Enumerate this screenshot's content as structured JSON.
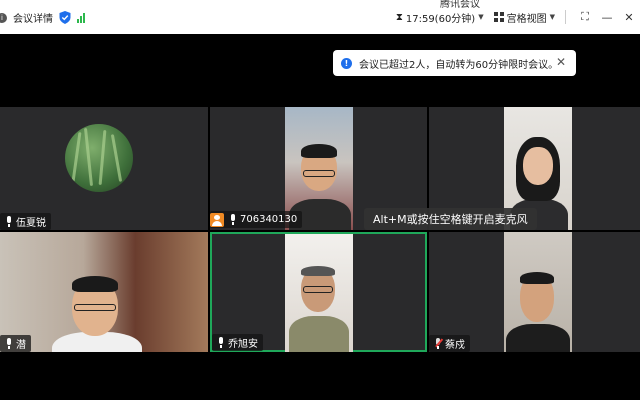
{
  "window": {
    "title": "腾讯会议"
  },
  "topbar": {
    "meeting_details_label": "会议详情",
    "timer_text": "17:59(60分钟)",
    "view_label": "宫格视图",
    "fullscreen_icon": "fullscreen-icon",
    "minimize_icon": "minimize-icon",
    "close_icon": "close-icon"
  },
  "notice": {
    "text": "会议已超过2人，自动转为60分钟限时会议。",
    "close_glyph": "✕"
  },
  "toast": {
    "text": "Alt+M或按住空格键开启麦克风"
  },
  "participants": [
    {
      "name": "伍夏锐",
      "mic": "on"
    },
    {
      "name": "706340130",
      "mic": "on",
      "host": true
    },
    {
      "name": ""
    },
    {
      "name": "潜",
      "mic": "on"
    },
    {
      "name": "乔旭安",
      "mic": "on",
      "speaking": true
    },
    {
      "name": "蔡戍",
      "mic": "muted"
    }
  ],
  "colors": {
    "active_border": "#1fa85a",
    "notice_icon": "#1f6feb",
    "host_badge": "#f08a24",
    "muted_slash": "#e53935"
  }
}
